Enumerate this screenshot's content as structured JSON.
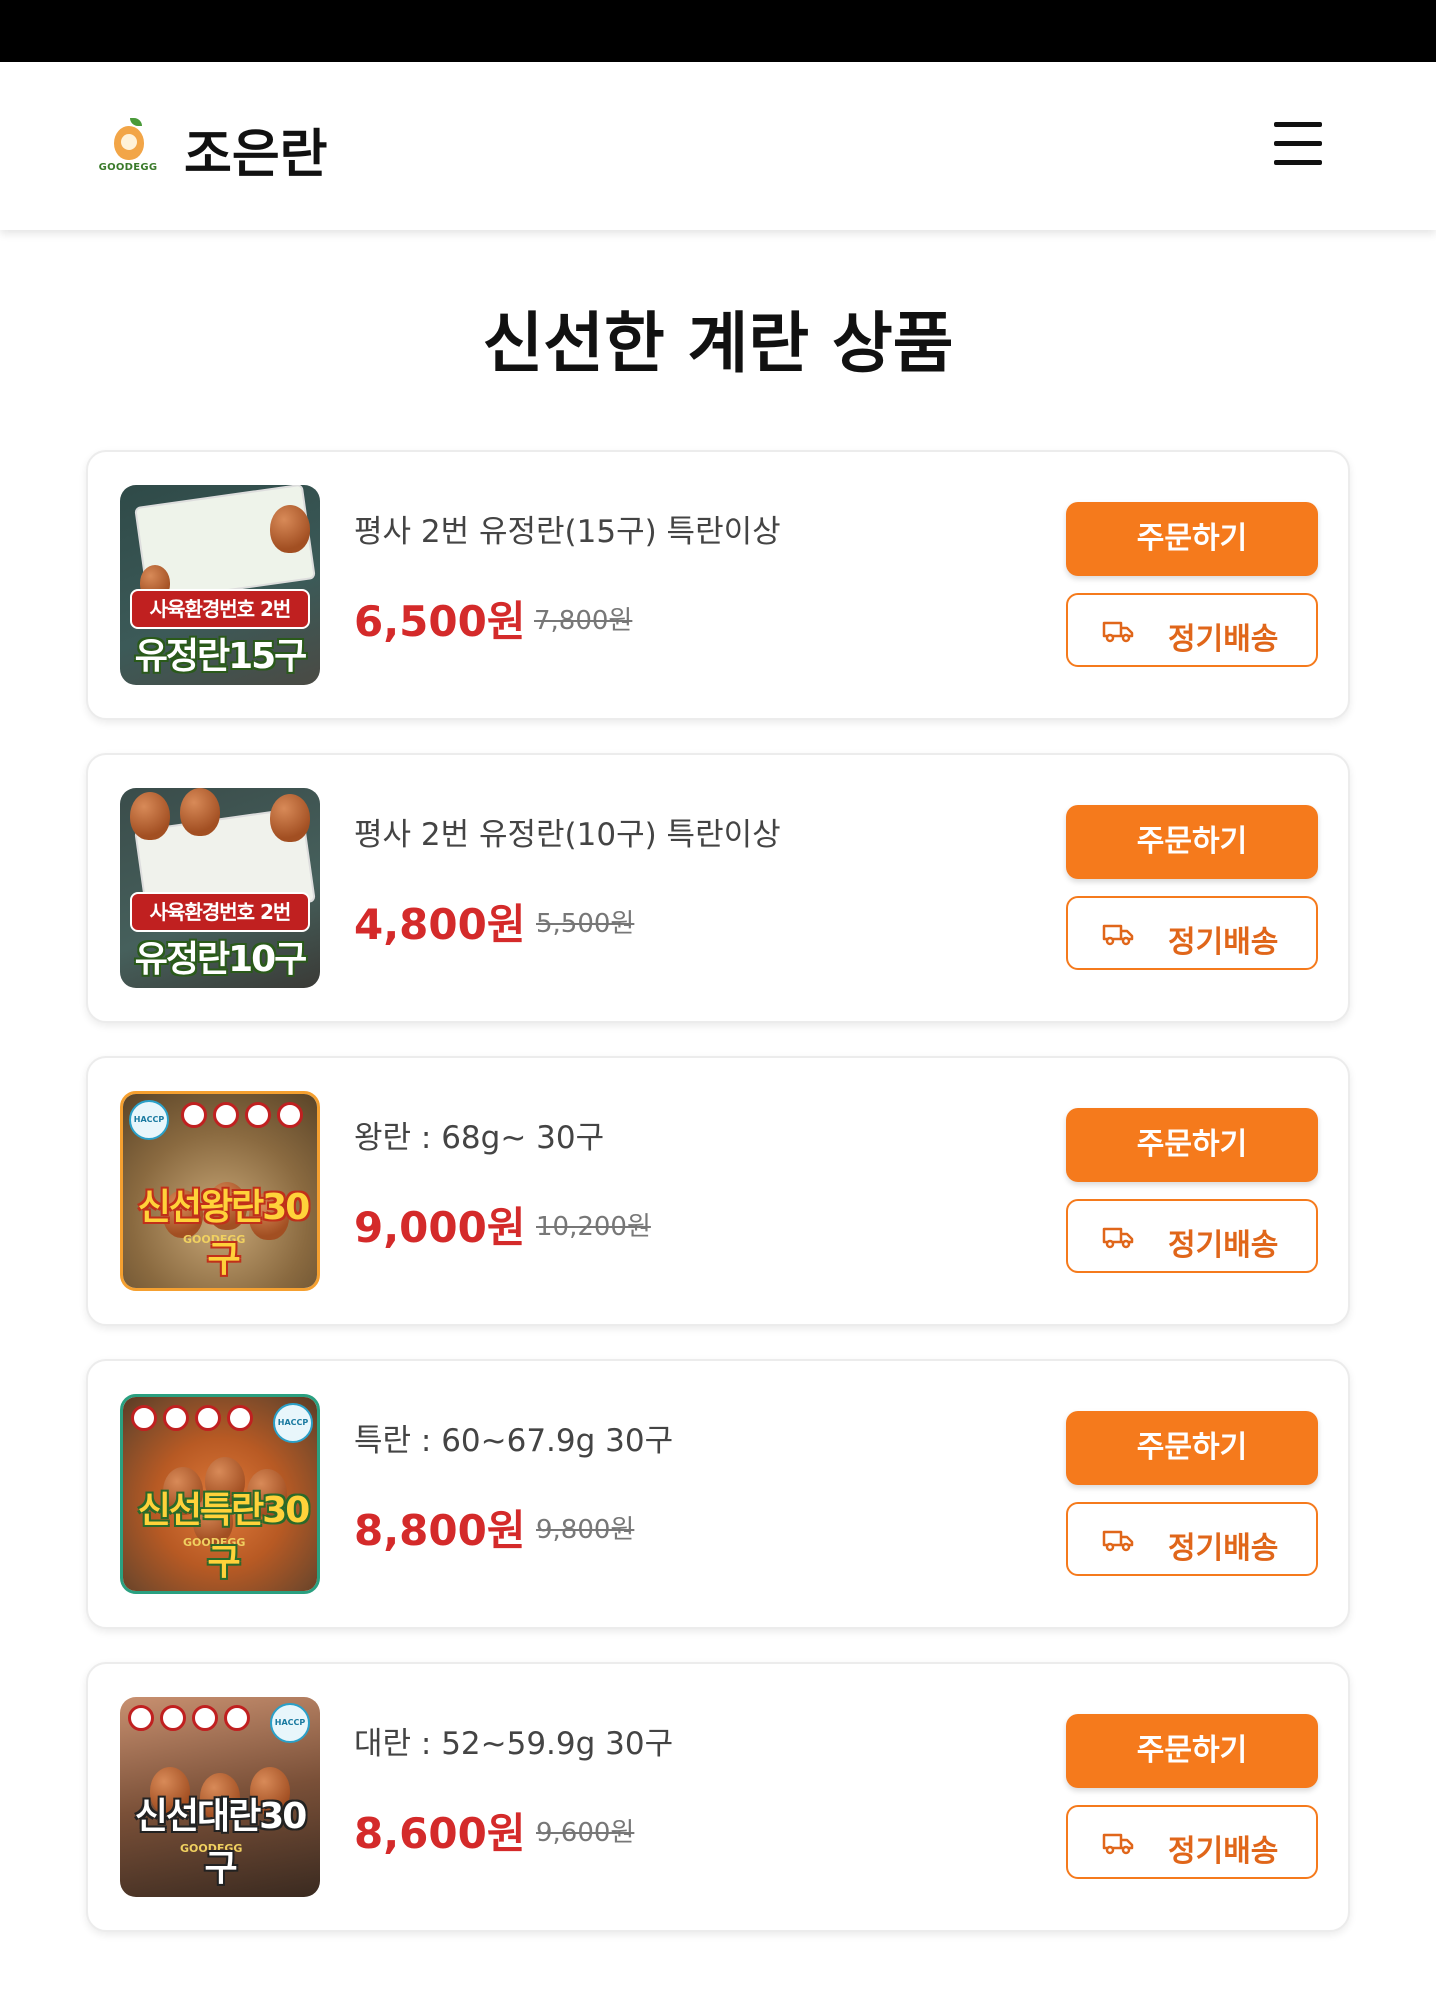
{
  "header": {
    "logo_text": "GOODEGG",
    "brand": "조은란",
    "menu_icon": "hamburger-menu-icon"
  },
  "page_title": "신선한 계란 상품",
  "products": [
    {
      "name": "평사 2번 유정란(15구) 특란이상",
      "price": "6,500원",
      "original_price": "7,800원",
      "order_label": "주문하기",
      "subscribe_label": "정기배송",
      "image_labels": [
        "사육환경번호 2번",
        "유정란15구"
      ]
    },
    {
      "name": "평사 2번 유정란(10구) 특란이상",
      "price": "4,800원",
      "original_price": "5,500원",
      "order_label": "주문하기",
      "subscribe_label": "정기배송",
      "image_labels": [
        "사육환경번호 2번",
        "유정란10구"
      ]
    },
    {
      "name": "왕란 : 68g~ 30구",
      "price": "9,000원",
      "original_price": "10,200원",
      "order_label": "주문하기",
      "subscribe_label": "정기배송",
      "image_labels": [
        "HACCP",
        "신선왕란30구"
      ]
    },
    {
      "name": "특란 : 60~67.9g 30구",
      "price": "8,800원",
      "original_price": "9,800원",
      "order_label": "주문하기",
      "subscribe_label": "정기배송",
      "image_labels": [
        "HACCP",
        "신선특란30구"
      ]
    },
    {
      "name": "대란 : 52~59.9g 30구",
      "price": "8,600원",
      "original_price": "9,600원",
      "order_label": "주문하기",
      "subscribe_label": "정기배송",
      "image_labels": [
        "HACCP",
        "신선대란30구"
      ]
    }
  ],
  "colors": {
    "accent": "#f57a1c",
    "price": "#d42a2a"
  }
}
